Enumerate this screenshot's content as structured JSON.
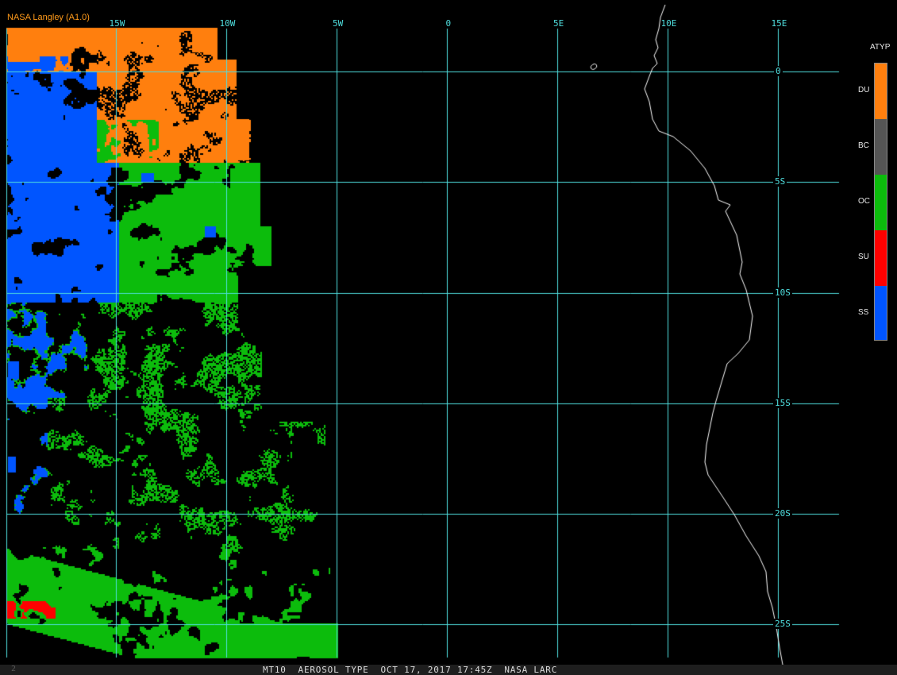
{
  "credit": "NASA Langley (A1.0)",
  "product_title": "MT10  AEROSOL TYPE  OCT 17, 2017 17:45Z  NASA LARC",
  "frame_index": "2",
  "colors": {
    "grid": "#4fdede",
    "coastline": "#ffffff",
    "background": "#000000"
  },
  "grid": {
    "longitudes": [
      {
        "label": "15W",
        "value": -15
      },
      {
        "label": "10W",
        "value": -10
      },
      {
        "label": "5W",
        "value": -5
      },
      {
        "label": "0",
        "value": 0
      },
      {
        "label": "5E",
        "value": 5
      },
      {
        "label": "10E",
        "value": 10
      },
      {
        "label": "15E",
        "value": 15
      }
    ],
    "latitudes": [
      {
        "label": "0",
        "value": 0
      },
      {
        "label": "5S",
        "value": -5
      },
      {
        "label": "10S",
        "value": -10
      },
      {
        "label": "15S",
        "value": -15
      },
      {
        "label": "20S",
        "value": -20
      },
      {
        "label": "25S",
        "value": -25
      }
    ]
  },
  "legend": {
    "title": "ATYP",
    "items": [
      {
        "code": "DU",
        "color": "#ff7f0e"
      },
      {
        "code": "BC",
        "color": "#555555"
      },
      {
        "code": "OC",
        "color": "#0cbc0c"
      },
      {
        "code": "SU",
        "color": "#ff0000"
      },
      {
        "code": "SS",
        "color": "#0055ff"
      }
    ]
  }
}
